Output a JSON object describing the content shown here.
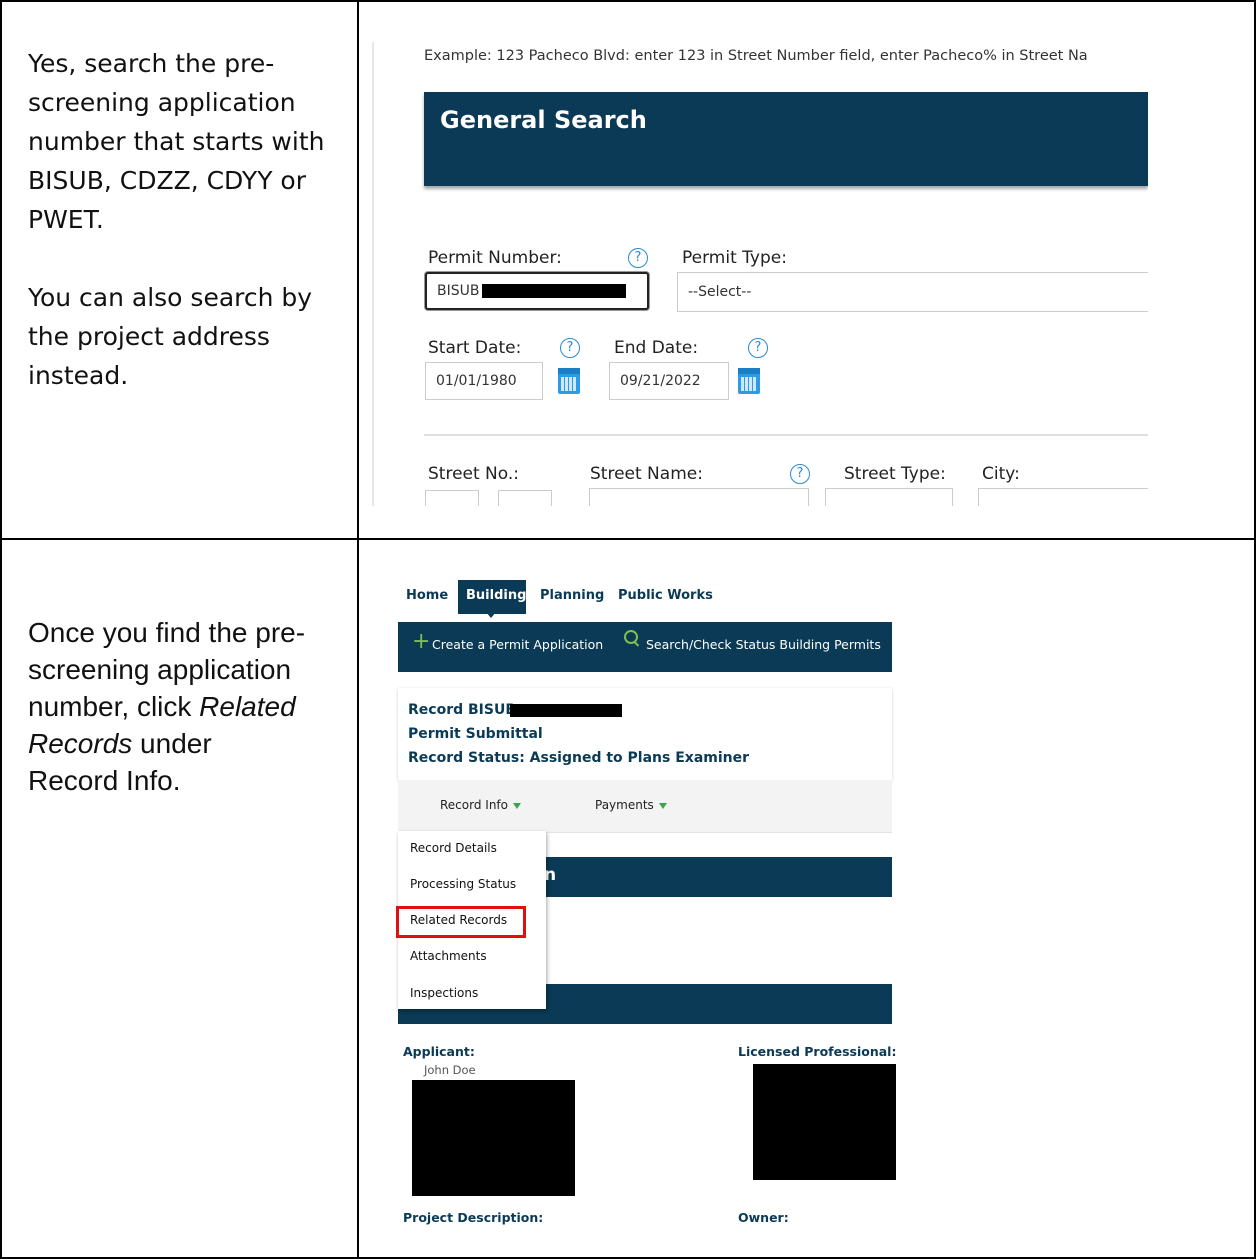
{
  "row1": {
    "instruction": {
      "para1": [
        "Yes, search the pre-",
        "screening application",
        "number that starts with",
        "BISUB, CDZZ, CDYY or",
        "PWET."
      ],
      "para2": [
        "You can also search by",
        "the project address",
        "instead."
      ]
    },
    "screenshot": {
      "example_text": "Example: 123 Pacheco Blvd: enter 123 in Street Number field, enter Pacheco% in Street Na",
      "section_title": "General Search",
      "permit_number_label": "Permit Number:",
      "permit_number_value": "BISUB",
      "permit_type_label": "Permit Type:",
      "permit_type_value": "--Select--",
      "start_date_label": "Start Date:",
      "start_date_value": "01/01/1980",
      "end_date_label": "End Date:",
      "end_date_value": "09/21/2022",
      "street_no_label": "Street No.:",
      "street_name_label": "Street Name:",
      "street_type_label": "Street Type:",
      "city_label": "City:",
      "help_glyph": "?"
    }
  },
  "row2": {
    "instruction": {
      "line1": "Once you find the pre-",
      "line2": "screening application",
      "line3_pre": "number, click ",
      "line3_em": "Related",
      "line4_em": "Records",
      "line4_post": " under",
      "line5": "Record Info."
    },
    "screenshot": {
      "nav": {
        "home": "Home",
        "building": "Building",
        "planning": "Planning",
        "public_works": "Public Works"
      },
      "actions": {
        "create": "Create a Permit Application",
        "search": "Search/Check Status Building Permits"
      },
      "record_id": "Record BISUB",
      "record_type": "Permit Submittal",
      "record_status": "Record Status: Assigned to Plans Examiner",
      "tabs": {
        "record_info": "Record Info",
        "payments": "Payments"
      },
      "menu": [
        "Record Details",
        "Processing Status",
        "Related Records",
        "Attachments",
        "Inspections"
      ],
      "section_fragment": "n",
      "applicant_label": "Applicant:",
      "applicant_name": "John Doe",
      "licensed_professional_label": "Licensed Professional:",
      "project_description_label": "Project Description:",
      "owner_label": "Owner:",
      "highlight_color": "#e01010",
      "brand_color": "#0a3a55"
    }
  }
}
